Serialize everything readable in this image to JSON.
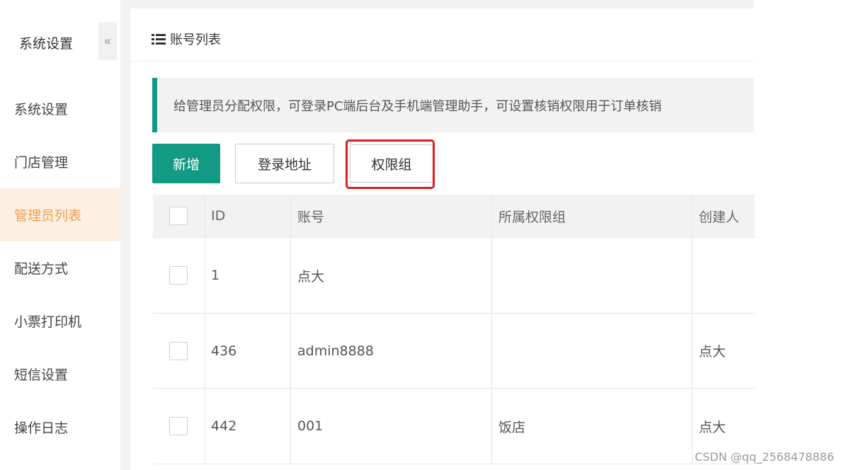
{
  "sidebar": {
    "title": "系统设置",
    "collapse_icon": "«",
    "items": [
      {
        "label": "系统设置"
      },
      {
        "label": "门店管理"
      },
      {
        "label": "管理员列表",
        "active": true
      },
      {
        "label": "配送方式"
      },
      {
        "label": "小票打印机"
      },
      {
        "label": "短信设置"
      },
      {
        "label": "操作日志"
      }
    ]
  },
  "panel": {
    "title": "账号列表",
    "title_icon": "list-icon"
  },
  "notice": {
    "text": "给管理员分配权限，可登录PC端后台及手机端管理助手，可设置核销权限用于订单核销"
  },
  "toolbar": {
    "add_label": "新增",
    "login_address_label": "登录地址",
    "permission_group_label": "权限组"
  },
  "table": {
    "headers": {
      "id": "ID",
      "account": "账号",
      "group": "所属权限组",
      "creator": "创建人"
    },
    "rows": [
      {
        "id": "1",
        "account": "点大",
        "group": "",
        "creator": ""
      },
      {
        "id": "436",
        "account": "admin8888",
        "group": "",
        "creator": "点大"
      },
      {
        "id": "442",
        "account": "001",
        "group": "饭店",
        "creator": "点大"
      }
    ]
  },
  "colors": {
    "primary": "#129a85",
    "active_nav_bg": "#fdefe2",
    "active_nav_text": "#f0a05a",
    "highlight": "#e11c1c"
  },
  "watermark": "CSDN @qq_2568478886"
}
